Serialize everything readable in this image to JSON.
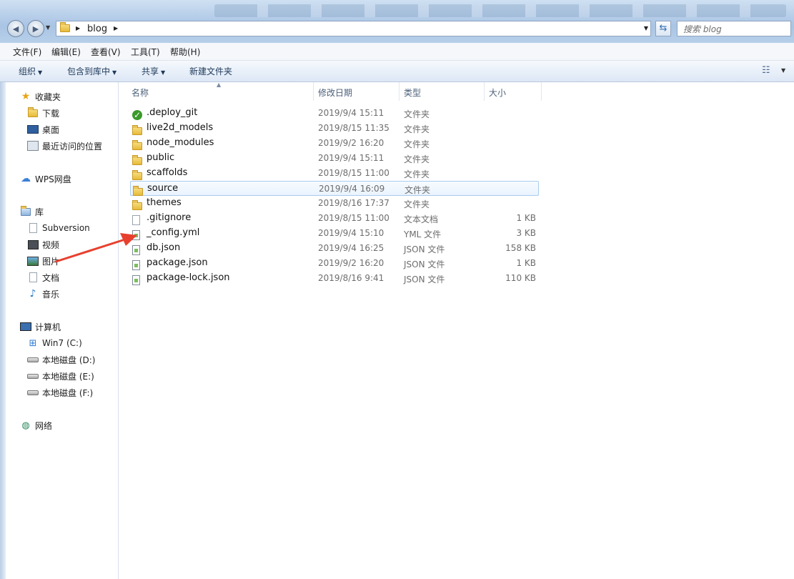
{
  "address": {
    "segments": [
      "blog"
    ]
  },
  "search": {
    "placeholder": "搜索 blog"
  },
  "menu": [
    "文件(F)",
    "编辑(E)",
    "查看(V)",
    "工具(T)",
    "帮助(H)"
  ],
  "toolbar": {
    "organize": "组织",
    "include_library": "包含到库中",
    "share": "共享",
    "new_folder": "新建文件夹"
  },
  "nav": {
    "favorites": "收藏夹",
    "downloads": "下载",
    "desktop": "桌面",
    "recent": "最近访问的位置",
    "wps": "WPS网盘",
    "libraries": "库",
    "subversion": "Subversion",
    "videos": "视频",
    "pictures": "图片",
    "documents": "文档",
    "music": "音乐",
    "computer": "计算机",
    "drive_c": "Win7 (C:)",
    "drive_d": "本地磁盘 (D:)",
    "drive_e": "本地磁盘 (E:)",
    "drive_f": "本地磁盘 (F:)",
    "network": "网络"
  },
  "columns": {
    "name": "名称",
    "date": "修改日期",
    "type": "类型",
    "size": "大小"
  },
  "files": [
    {
      "name": ".deploy_git",
      "date": "2019/9/4 15:11",
      "type": "文件夹",
      "size": "",
      "icon": "git-folder-icon"
    },
    {
      "name": "live2d_models",
      "date": "2019/8/15 11:35",
      "type": "文件夹",
      "size": "",
      "icon": "folder-icon"
    },
    {
      "name": "node_modules",
      "date": "2019/9/2 16:20",
      "type": "文件夹",
      "size": "",
      "icon": "folder-icon"
    },
    {
      "name": "public",
      "date": "2019/9/4 15:11",
      "type": "文件夹",
      "size": "",
      "icon": "folder-icon"
    },
    {
      "name": "scaffolds",
      "date": "2019/8/15 11:00",
      "type": "文件夹",
      "size": "",
      "icon": "folder-icon"
    },
    {
      "name": "source",
      "date": "2019/9/4 16:09",
      "type": "文件夹",
      "size": "",
      "icon": "folder-icon"
    },
    {
      "name": "themes",
      "date": "2019/8/16 17:37",
      "type": "文件夹",
      "size": "",
      "icon": "folder-icon"
    },
    {
      "name": ".gitignore",
      "date": "2019/8/15 11:00",
      "type": "文本文档",
      "size": "1 KB",
      "icon": "text-file-icon"
    },
    {
      "name": "_config.yml",
      "date": "2019/9/4 15:10",
      "type": "YML 文件",
      "size": "3 KB",
      "icon": "yml-file-icon"
    },
    {
      "name": "db.json",
      "date": "2019/9/4 16:25",
      "type": "JSON 文件",
      "size": "158 KB",
      "icon": "json-file-icon"
    },
    {
      "name": "package.json",
      "date": "2019/9/2 16:20",
      "type": "JSON 文件",
      "size": "1 KB",
      "icon": "json-file-icon"
    },
    {
      "name": "package-lock.json",
      "date": "2019/8/16 9:41",
      "type": "JSON 文件",
      "size": "110 KB",
      "icon": "json-file-icon"
    }
  ],
  "selected_row": "source",
  "colors": {
    "annotation_arrow": "#e8402f",
    "selection": "#a9cbee"
  }
}
